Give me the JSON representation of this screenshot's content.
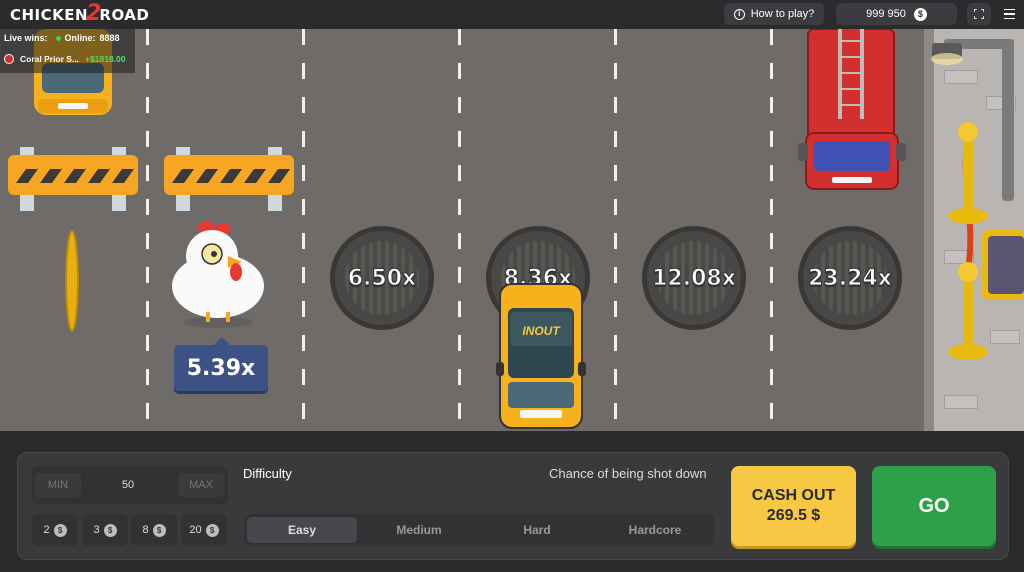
{
  "header": {
    "logo_left": "CHICKEN",
    "logo_number": "2",
    "logo_right": "ROAD",
    "help_label": "How to play?",
    "balance": "999 950",
    "currency_symbol": "$"
  },
  "live": {
    "live_wins_label": "Live wins:",
    "online_label": "Online:",
    "online_count": "8888",
    "recent_winner_name": "Coral Prior S...",
    "recent_winner_amount": "+$1818.00"
  },
  "game": {
    "chicken_multiplier": "5.39x",
    "lane_multipliers": [
      "6.50x",
      "8.36x",
      "12.08x",
      "23.24x"
    ],
    "taxi_brand": "INOUT"
  },
  "controls": {
    "bet": {
      "min_label": "MIN",
      "max_label": "MAX",
      "value": "50"
    },
    "quick_bets": [
      "2",
      "3",
      "8",
      "20"
    ],
    "chip_currency": "$",
    "difficulty_label": "Difficulty",
    "chance_label": "Chance of being shot down",
    "difficulties": [
      "Easy",
      "Medium",
      "Hard",
      "Hardcore"
    ],
    "selected_difficulty": "Easy",
    "cashout_label": "CASH OUT",
    "cashout_amount": "269.5 $",
    "go_label": "GO"
  },
  "colors": {
    "accent_cashout": "#f6c843",
    "accent_go": "#2fa04a",
    "multiplier_badge": "#3c5285",
    "road": "#6e6b68"
  }
}
